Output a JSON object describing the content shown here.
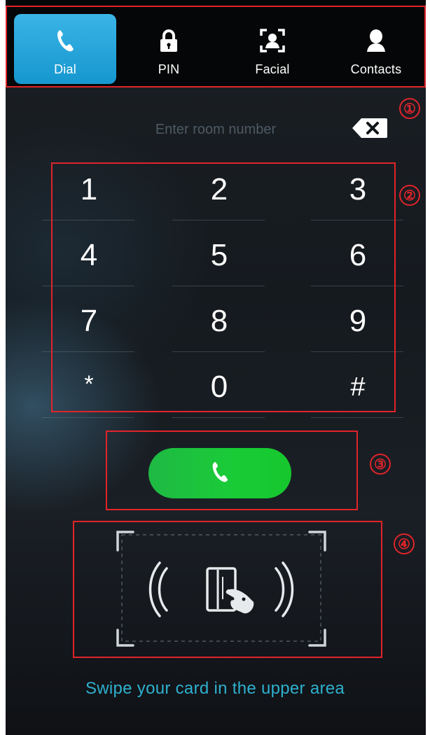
{
  "tabs": [
    {
      "label": "Dial",
      "icon": "phone-icon",
      "active": true
    },
    {
      "label": "PIN",
      "icon": "lock-icon",
      "active": false
    },
    {
      "label": "Facial",
      "icon": "face-scan-icon",
      "active": false
    },
    {
      "label": "Contacts",
      "icon": "person-icon",
      "active": false
    }
  ],
  "room_input": {
    "placeholder": "Enter room number",
    "value": ""
  },
  "keypad": {
    "keys": [
      "1",
      "2",
      "3",
      "4",
      "5",
      "6",
      "7",
      "8",
      "9",
      "*",
      "0",
      "#"
    ]
  },
  "markers": [
    "①",
    "②",
    "③",
    "④"
  ],
  "call_button": {
    "icon": "phone-icon",
    "color": "#1fc93a"
  },
  "card": {
    "icon": "card-tap-icon",
    "hint": "Swipe your card in the upper area"
  },
  "colors": {
    "accent": "#2ba6dc",
    "highlight_box": "#e0242a",
    "hint_text": "#2fb0cf"
  }
}
